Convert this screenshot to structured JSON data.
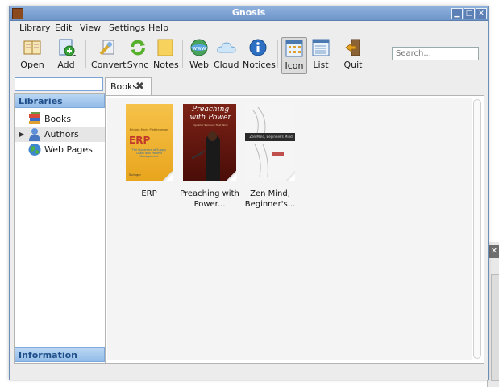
{
  "window": {
    "title": "Gnosis"
  },
  "menubar": [
    "Library",
    "Edit",
    "View",
    "Settings",
    "Help"
  ],
  "toolbar": {
    "open": "Open",
    "add": "Add",
    "convert": "Convert",
    "sync": "Sync",
    "notes": "Notes",
    "web": "Web",
    "cloud": "Cloud",
    "notices": "Notices",
    "icon": "Icon",
    "list": "List",
    "quit": "Quit"
  },
  "search": {
    "placeholder": "Search..."
  },
  "sidebar": {
    "libraries_header": "Libraries",
    "items": [
      {
        "label": "Books",
        "icon": "books-icon"
      },
      {
        "label": "Authors",
        "icon": "user-icon"
      },
      {
        "label": "Web Pages",
        "icon": "globe-icon"
      }
    ],
    "information_header": "Information"
  },
  "tab": {
    "label": "Books"
  },
  "books": [
    {
      "label": "ERP",
      "cover_title": "ERP",
      "cover_top": "Bridget-Marie Plattenberger",
      "cover_sub": "The Dynamics of Supply Chain and Process Management",
      "cover_foot": "Springer"
    },
    {
      "label": "Preaching with Power...",
      "cover_title": "Preaching with Power",
      "cover_sub": "Dynamic Sermons That Work"
    },
    {
      "label": "Zen Mind, Beginner's...",
      "cover_band": "Zen Mind, Beginner's Mind"
    }
  ],
  "colors": {
    "accent": "#93bce8",
    "titlebar": "#7b9fd3"
  }
}
